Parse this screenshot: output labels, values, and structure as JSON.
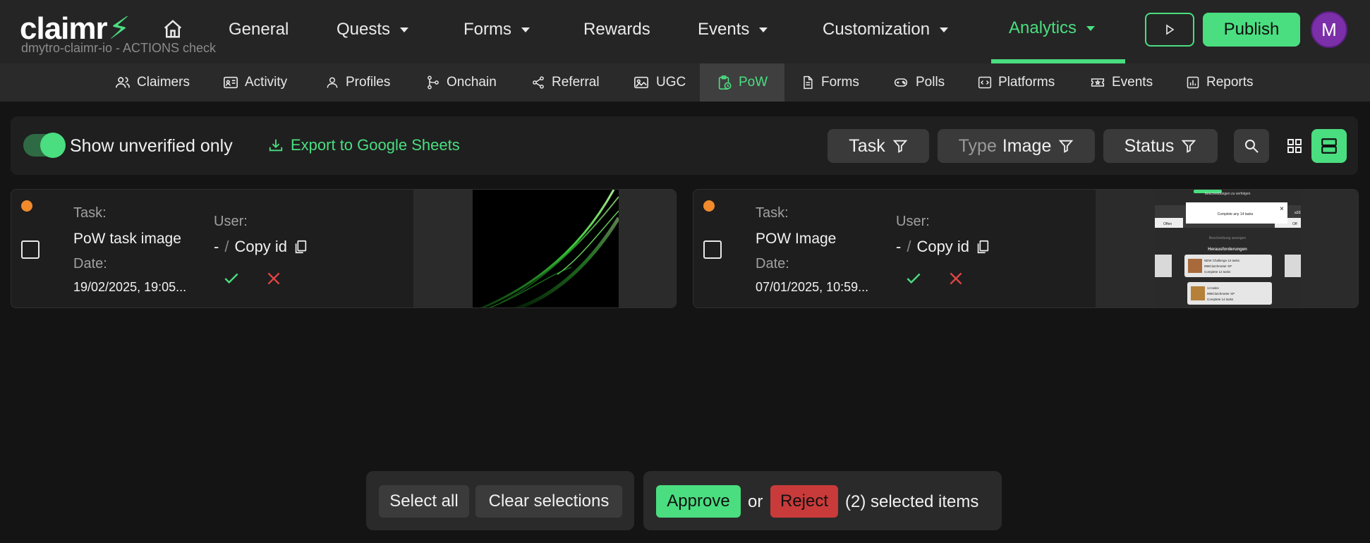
{
  "header": {
    "logo": "claimr",
    "subtitle": "dmytro-claimr-io - ACTIONS check",
    "nav": [
      {
        "label": "General"
      },
      {
        "label": "Quests"
      },
      {
        "label": "Forms"
      },
      {
        "label": "Rewards"
      },
      {
        "label": "Events"
      },
      {
        "label": "Customization"
      },
      {
        "label": "Analytics"
      }
    ],
    "publish_label": "Publish",
    "avatar_initial": "M"
  },
  "subnav": {
    "items": [
      {
        "label": "Claimers"
      },
      {
        "label": "Activity"
      },
      {
        "label": "Profiles"
      },
      {
        "label": "Onchain"
      },
      {
        "label": "Referral"
      },
      {
        "label": "UGC"
      },
      {
        "label": "PoW"
      },
      {
        "label": "Forms"
      },
      {
        "label": "Polls"
      },
      {
        "label": "Platforms"
      },
      {
        "label": "Events"
      },
      {
        "label": "Reports"
      }
    ],
    "active": "PoW"
  },
  "toolbar": {
    "toggle_label": "Show unverified only",
    "toggle_on": true,
    "export_label": "Export to Google Sheets",
    "filters": {
      "task": "Task",
      "type_prefix": "Type",
      "type_value": "Image",
      "status": "Status"
    }
  },
  "cards": [
    {
      "task_label": "Task:",
      "task": "PoW task image",
      "date_label": "Date:",
      "date": "19/02/2025, 19:05...",
      "user_label": "User:",
      "user_dash": "-",
      "user_sep": "/",
      "copy_label": "Copy id"
    },
    {
      "task_label": "Task:",
      "task": "POW Image",
      "date_label": "Date:",
      "date": "07/01/2025, 10:59...",
      "user_label": "User:",
      "user_dash": "-",
      "user_sep": "/",
      "copy_label": "Copy id",
      "thumb_text": {
        "top": "Beschreibungen zu verfolgen",
        "popup": "Complete any 14 tasks",
        "left_tab": "Offen",
        "right_tab": "Off",
        "link": "Beschreibung anzeigen",
        "section": "Herausforderungen",
        "item1_title": "NEW Challenge 12 tasks",
        "item1_xp": "999Clutchmeter XP",
        "item1_desc": "Complete 12 tasks",
        "item2_title": "14 tasks",
        "item2_xp": "999Clutchmeter XP",
        "item2_desc": "Complete 14 tasks",
        "user": "a333"
      }
    }
  ],
  "bulk": {
    "select_all": "Select all",
    "clear": "Clear selections",
    "approve": "Approve",
    "or": "or",
    "reject": "Reject",
    "count_text": "(2) selected items"
  },
  "colors": {
    "accent": "#4ade80",
    "reject": "#c93a3a",
    "pending_dot": "#f08a2c",
    "avatar": "#7b2fa8"
  }
}
